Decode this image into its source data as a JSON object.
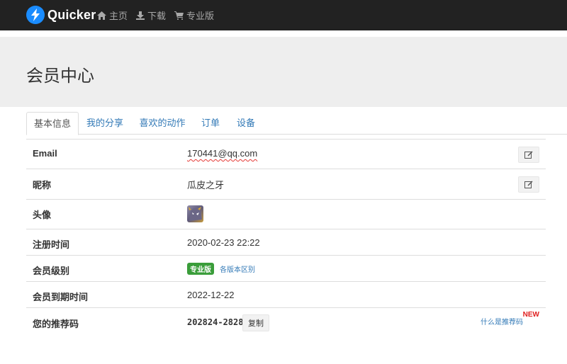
{
  "navbar": {
    "brand": "Quicker",
    "items": [
      {
        "label": "主页",
        "icon": "home-icon"
      },
      {
        "label": "下载",
        "icon": "download-icon"
      },
      {
        "label": "专业版",
        "icon": "cart-icon"
      }
    ],
    "brand_color": "#1a8cff",
    "bg_color": "#222222"
  },
  "page_title": "会员中心",
  "tabs": [
    "基本信息",
    "我的分享",
    "喜欢的动作",
    "订单",
    "设备"
  ],
  "active_tab": "基本信息",
  "profile": {
    "email_label": "Email",
    "email_value": "170441@qq.com",
    "nickname_label": "昵称",
    "nickname_value": "瓜皮之牙",
    "avatar_label": "头像",
    "reg_time_label": "注册时间",
    "reg_time_value": "2020-02-23 22:22",
    "level_label": "会员级别",
    "level_badge": "专业版",
    "level_diff_link": "各版本区别",
    "expire_label": "会员到期时间",
    "expire_value": "2022-12-22",
    "referral_label": "您的推荐码",
    "referral_code": "202824-2828",
    "copy_button": "复制",
    "what_is_referral": "什么是推荐码",
    "new_badge": "NEW"
  }
}
